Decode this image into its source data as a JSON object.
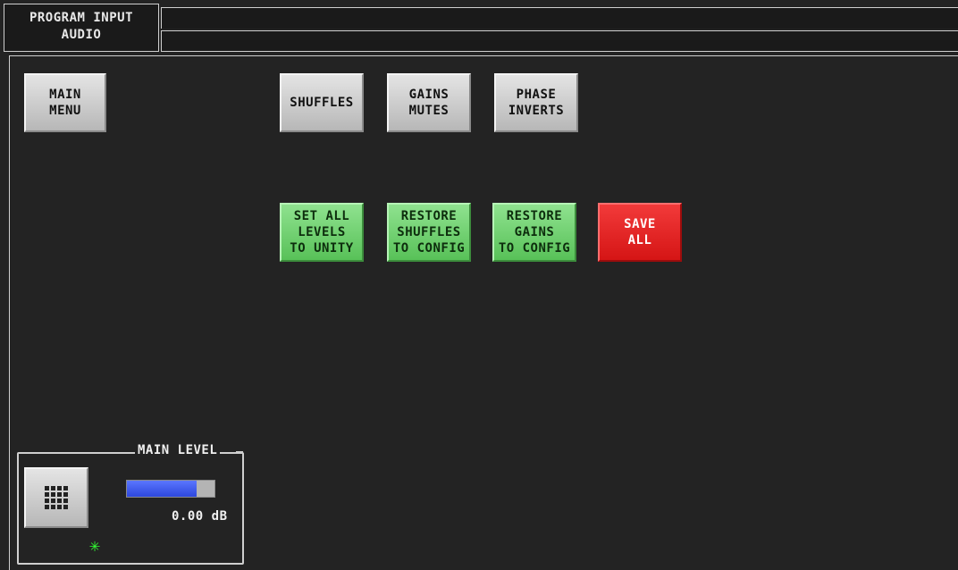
{
  "header": {
    "title_line1": "PROGRAM INPUT",
    "title_line2": "AUDIO"
  },
  "nav": {
    "main_menu": "MAIN\nMENU",
    "shuffles": "SHUFFLES",
    "gains_mutes": "GAINS\nMUTES",
    "phase_inverts": "PHASE\nINVERTS"
  },
  "actions": {
    "set_all_levels": "SET ALL\nLEVELS\nTO UNITY",
    "restore_shuffles": "RESTORE\nSHUFFLES\nTO CONFIG",
    "restore_gains": "RESTORE\nGAINS\nTO CONFIG",
    "save_all": "SAVE\nALL"
  },
  "main_level": {
    "label": "MAIN LEVEL",
    "value": "0.00 dB",
    "meter_fraction": 0.8,
    "keypad_icon": "keypad-icon",
    "status_icon": "green-star-indicator"
  },
  "colors": {
    "background": "#232323",
    "action_green": "#6fd36f",
    "save_red": "#e41f1f",
    "meter_blue": "#3f5cf0"
  }
}
